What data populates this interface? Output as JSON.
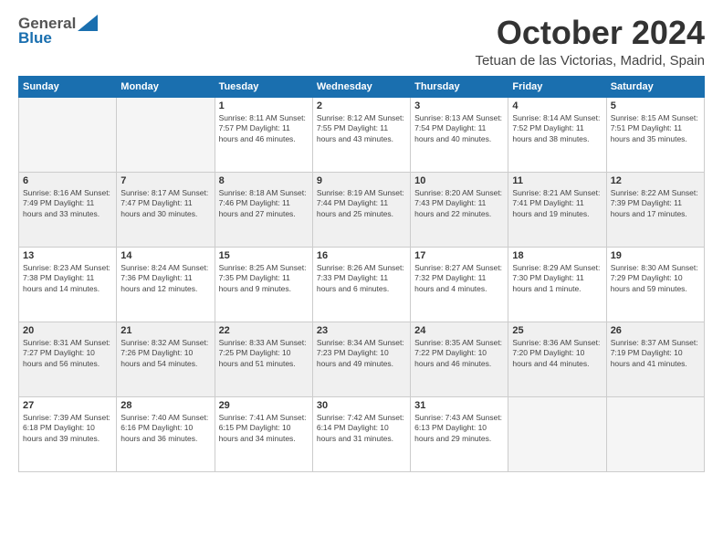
{
  "header": {
    "logo_general": "General",
    "logo_blue": "Blue",
    "month_title": "October 2024",
    "location": "Tetuan de las Victorias, Madrid, Spain"
  },
  "weekdays": [
    "Sunday",
    "Monday",
    "Tuesday",
    "Wednesday",
    "Thursday",
    "Friday",
    "Saturday"
  ],
  "weeks": [
    [
      {
        "day": "",
        "detail": ""
      },
      {
        "day": "",
        "detail": ""
      },
      {
        "day": "1",
        "detail": "Sunrise: 8:11 AM\nSunset: 7:57 PM\nDaylight: 11 hours and 46 minutes."
      },
      {
        "day": "2",
        "detail": "Sunrise: 8:12 AM\nSunset: 7:55 PM\nDaylight: 11 hours and 43 minutes."
      },
      {
        "day": "3",
        "detail": "Sunrise: 8:13 AM\nSunset: 7:54 PM\nDaylight: 11 hours and 40 minutes."
      },
      {
        "day": "4",
        "detail": "Sunrise: 8:14 AM\nSunset: 7:52 PM\nDaylight: 11 hours and 38 minutes."
      },
      {
        "day": "5",
        "detail": "Sunrise: 8:15 AM\nSunset: 7:51 PM\nDaylight: 11 hours and 35 minutes."
      }
    ],
    [
      {
        "day": "6",
        "detail": "Sunrise: 8:16 AM\nSunset: 7:49 PM\nDaylight: 11 hours and 33 minutes."
      },
      {
        "day": "7",
        "detail": "Sunrise: 8:17 AM\nSunset: 7:47 PM\nDaylight: 11 hours and 30 minutes."
      },
      {
        "day": "8",
        "detail": "Sunrise: 8:18 AM\nSunset: 7:46 PM\nDaylight: 11 hours and 27 minutes."
      },
      {
        "day": "9",
        "detail": "Sunrise: 8:19 AM\nSunset: 7:44 PM\nDaylight: 11 hours and 25 minutes."
      },
      {
        "day": "10",
        "detail": "Sunrise: 8:20 AM\nSunset: 7:43 PM\nDaylight: 11 hours and 22 minutes."
      },
      {
        "day": "11",
        "detail": "Sunrise: 8:21 AM\nSunset: 7:41 PM\nDaylight: 11 hours and 19 minutes."
      },
      {
        "day": "12",
        "detail": "Sunrise: 8:22 AM\nSunset: 7:39 PM\nDaylight: 11 hours and 17 minutes."
      }
    ],
    [
      {
        "day": "13",
        "detail": "Sunrise: 8:23 AM\nSunset: 7:38 PM\nDaylight: 11 hours and 14 minutes."
      },
      {
        "day": "14",
        "detail": "Sunrise: 8:24 AM\nSunset: 7:36 PM\nDaylight: 11 hours and 12 minutes."
      },
      {
        "day": "15",
        "detail": "Sunrise: 8:25 AM\nSunset: 7:35 PM\nDaylight: 11 hours and 9 minutes."
      },
      {
        "day": "16",
        "detail": "Sunrise: 8:26 AM\nSunset: 7:33 PM\nDaylight: 11 hours and 6 minutes."
      },
      {
        "day": "17",
        "detail": "Sunrise: 8:27 AM\nSunset: 7:32 PM\nDaylight: 11 hours and 4 minutes."
      },
      {
        "day": "18",
        "detail": "Sunrise: 8:29 AM\nSunset: 7:30 PM\nDaylight: 11 hours and 1 minute."
      },
      {
        "day": "19",
        "detail": "Sunrise: 8:30 AM\nSunset: 7:29 PM\nDaylight: 10 hours and 59 minutes."
      }
    ],
    [
      {
        "day": "20",
        "detail": "Sunrise: 8:31 AM\nSunset: 7:27 PM\nDaylight: 10 hours and 56 minutes."
      },
      {
        "day": "21",
        "detail": "Sunrise: 8:32 AM\nSunset: 7:26 PM\nDaylight: 10 hours and 54 minutes."
      },
      {
        "day": "22",
        "detail": "Sunrise: 8:33 AM\nSunset: 7:25 PM\nDaylight: 10 hours and 51 minutes."
      },
      {
        "day": "23",
        "detail": "Sunrise: 8:34 AM\nSunset: 7:23 PM\nDaylight: 10 hours and 49 minutes."
      },
      {
        "day": "24",
        "detail": "Sunrise: 8:35 AM\nSunset: 7:22 PM\nDaylight: 10 hours and 46 minutes."
      },
      {
        "day": "25",
        "detail": "Sunrise: 8:36 AM\nSunset: 7:20 PM\nDaylight: 10 hours and 44 minutes."
      },
      {
        "day": "26",
        "detail": "Sunrise: 8:37 AM\nSunset: 7:19 PM\nDaylight: 10 hours and 41 minutes."
      }
    ],
    [
      {
        "day": "27",
        "detail": "Sunrise: 7:39 AM\nSunset: 6:18 PM\nDaylight: 10 hours and 39 minutes."
      },
      {
        "day": "28",
        "detail": "Sunrise: 7:40 AM\nSunset: 6:16 PM\nDaylight: 10 hours and 36 minutes."
      },
      {
        "day": "29",
        "detail": "Sunrise: 7:41 AM\nSunset: 6:15 PM\nDaylight: 10 hours and 34 minutes."
      },
      {
        "day": "30",
        "detail": "Sunrise: 7:42 AM\nSunset: 6:14 PM\nDaylight: 10 hours and 31 minutes."
      },
      {
        "day": "31",
        "detail": "Sunrise: 7:43 AM\nSunset: 6:13 PM\nDaylight: 10 hours and 29 minutes."
      },
      {
        "day": "",
        "detail": ""
      },
      {
        "day": "",
        "detail": ""
      }
    ]
  ]
}
